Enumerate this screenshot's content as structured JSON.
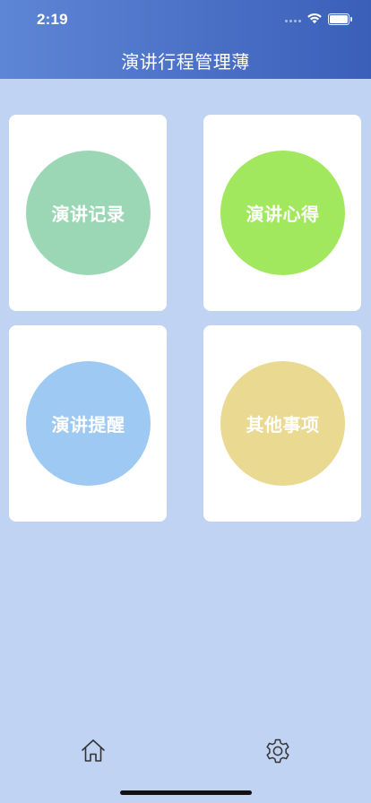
{
  "status_bar": {
    "time": "2:19"
  },
  "header": {
    "title": "演讲行程管理薄"
  },
  "cards": [
    {
      "label": "演讲记录",
      "color": "#9bd7b4"
    },
    {
      "label": "演讲心得",
      "color": "#a2e85e"
    },
    {
      "label": "演讲提醒",
      "color": "#9ec9f2"
    },
    {
      "label": "其他事项",
      "color": "#ead991"
    }
  ],
  "tabbar": {
    "items": [
      {
        "icon": "home-icon"
      },
      {
        "icon": "gear-icon"
      }
    ]
  },
  "colors": {
    "background": "#c0d3f2",
    "header_start": "#5e86d6",
    "header_end": "#3a5fb9"
  }
}
